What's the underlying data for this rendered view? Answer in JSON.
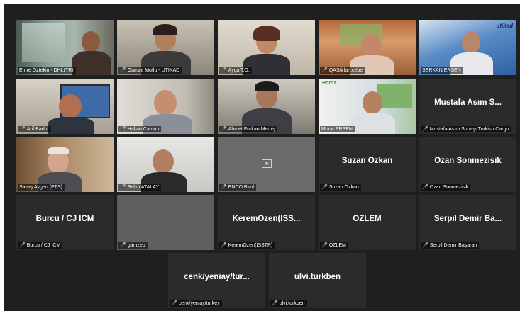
{
  "meeting": {
    "participants": [
      {
        "name": "Emre Öztekin - DHL(TR)",
        "video": true,
        "muted": false
      },
      {
        "name": "Gamze Mutlu - UTİKAD",
        "video": true,
        "muted": true
      },
      {
        "name": "Ayça T.O.",
        "video": true,
        "muted": true
      },
      {
        "name": "QAS/irfan.cebe",
        "video": true,
        "muted": true
      },
      {
        "name": "SERKAN ERSEN",
        "video": true,
        "muted": false,
        "logo": "utikad"
      },
      {
        "name": "Arif Badur",
        "video": true,
        "muted": true
      },
      {
        "name": "Hakan Caman",
        "video": true,
        "muted": true
      },
      {
        "name": "Ahmet Furkan Memiş",
        "video": true,
        "muted": true
      },
      {
        "name": "Murat ERSEN",
        "video": true,
        "muted": false,
        "logo": "Horoz"
      },
      {
        "display": "Mustafa Asım S...",
        "name": "Mustafa Asım Subaşı Turkish Cargo",
        "video": false,
        "muted": true
      },
      {
        "name": "Savaş Aygen (PTS)",
        "video": true,
        "muted": false
      },
      {
        "name": "Selim ATALAY",
        "video": true,
        "muted": true
      },
      {
        "name": "ENCO Birol",
        "video": false,
        "muted": true,
        "avatar": true
      },
      {
        "display": "Suzan Özkan",
        "name": "Suzan Özkan",
        "video": false,
        "muted": true
      },
      {
        "display": "Ozan Sonmezisik",
        "name": "Ozan Sonmezisik",
        "video": false,
        "muted": true
      },
      {
        "display": "Burcu / CJ ICM",
        "name": "Burcu / CJ ICM",
        "video": false,
        "muted": true
      },
      {
        "name": "gamzeo",
        "video": false,
        "muted": true,
        "blank": true
      },
      {
        "display": "KeremOzen(ISS...",
        "name": "KeremOzen(ISSTR)",
        "video": false,
        "muted": true
      },
      {
        "display": "ÖZLEM",
        "name": "ÖZLEM",
        "video": false,
        "muted": true
      },
      {
        "display": "Serpil Demir Ba...",
        "name": "Serpil Demir Başaran",
        "video": false,
        "muted": true
      },
      {
        "display": "cenk/yeniay/tur...",
        "name": "cenk/yeniay/turkey",
        "video": false,
        "muted": true
      },
      {
        "display": "ulvi.turkben",
        "name": "ulvi.turkben",
        "video": false,
        "muted": true
      }
    ]
  }
}
